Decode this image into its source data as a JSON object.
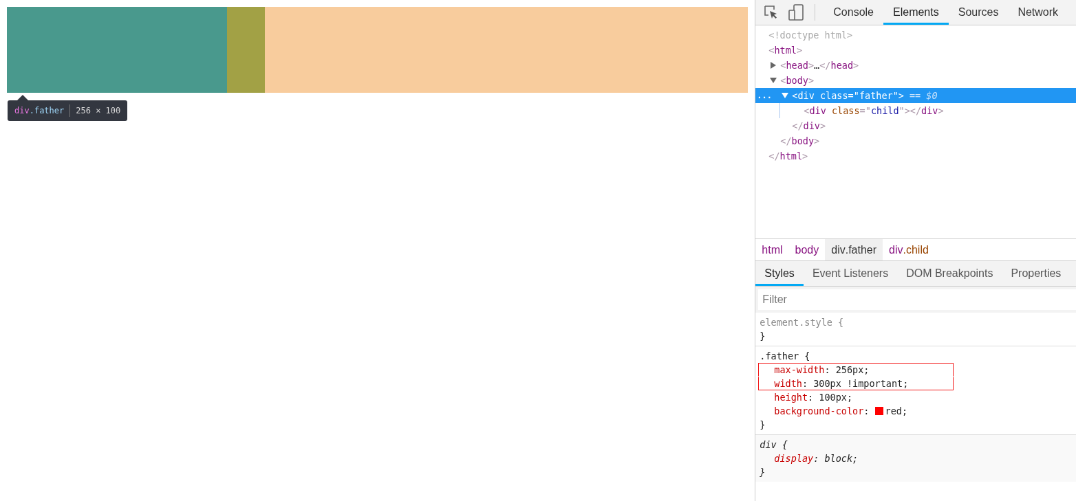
{
  "page": {
    "tooltip": {
      "selector_tag": "div",
      "selector_class": ".father",
      "size": "256 × 100"
    }
  },
  "devtools": {
    "tabs": [
      {
        "label": "Console",
        "selected": false
      },
      {
        "label": "Elements",
        "selected": true
      },
      {
        "label": "Sources",
        "selected": false
      },
      {
        "label": "Network",
        "selected": false
      }
    ],
    "dom_tree": [
      {
        "selected": false,
        "open": [
          {
            "c": "<!doctype html>"
          }
        ]
      },
      {
        "selected": false,
        "open": [
          {
            "p": "<"
          },
          {
            "t": "html"
          },
          {
            "p": ">"
          }
        ],
        "close": [
          {
            "p": "</"
          },
          {
            "t": "html"
          },
          {
            "p": ">"
          }
        ],
        "children": [
          {
            "selected": false,
            "expanded": false,
            "open": [
              {
                "p": "<"
              },
              {
                "t": "head"
              },
              {
                "p": ">"
              },
              {
                "x": "…"
              },
              {
                "p": "</"
              },
              {
                "t": "head"
              },
              {
                "p": ">"
              }
            ]
          },
          {
            "selected": false,
            "expanded": true,
            "open": [
              {
                "p": "<"
              },
              {
                "t": "body"
              },
              {
                "p": ">"
              }
            ],
            "close": [
              {
                "p": "</"
              },
              {
                "t": "body"
              },
              {
                "p": ">"
              }
            ],
            "children": [
              {
                "selected": true,
                "expanded": true,
                "marker": "...",
                "suffix": "== $0",
                "open": [
                  {
                    "p": "<"
                  },
                  {
                    "t": "div"
                  },
                  {
                    "a": " class"
                  },
                  {
                    "p": "=\""
                  },
                  {
                    "v": "father"
                  },
                  {
                    "p": "\">"
                  }
                ],
                "close": [
                  {
                    "p": "</"
                  },
                  {
                    "t": "div"
                  },
                  {
                    "p": ">"
                  }
                ],
                "children": [
                  {
                    "selected": false,
                    "open": [
                      {
                        "p": "<"
                      },
                      {
                        "t": "div"
                      },
                      {
                        "a": " class"
                      },
                      {
                        "p": "=\""
                      },
                      {
                        "v": "child"
                      },
                      {
                        "p": "\"></"
                      },
                      {
                        "t": "div"
                      },
                      {
                        "p": ">"
                      }
                    ]
                  }
                ]
              }
            ]
          }
        ]
      }
    ],
    "breadcrumbs": [
      {
        "tag": "html",
        "selected": false
      },
      {
        "tag": "body",
        "selected": false
      },
      {
        "tag": "div",
        "cls": ".father",
        "selected": true
      },
      {
        "tag": "div",
        "cls": ".child",
        "selected": false
      }
    ],
    "subtabs": [
      {
        "label": "Styles",
        "selected": true
      },
      {
        "label": "Event Listeners",
        "selected": false
      },
      {
        "label": "DOM Breakpoints",
        "selected": false
      },
      {
        "label": "Properties",
        "selected": false
      }
    ],
    "filter": {
      "placeholder": "Filter"
    },
    "rules": [
      {
        "kind": "inline",
        "selector": "element.style {",
        "end": "}"
      },
      {
        "kind": "author",
        "selector": ".father {",
        "end": "}",
        "declarations": [
          {
            "property": "max-width",
            "colon": ":",
            "value": "256px;",
            "boxed": true
          },
          {
            "property": "width",
            "colon": ":",
            "value": "300px !important;",
            "boxed": true
          },
          {
            "property": "height",
            "colon": ":",
            "value": "100px;",
            "boxed": false
          },
          {
            "property": "background-color",
            "colon": ":",
            "value": "red;",
            "color": "#ff0000",
            "boxed": false
          }
        ]
      },
      {
        "kind": "useragent",
        "selector": "div {",
        "end": "}",
        "declarations": [
          {
            "property": "display",
            "colon": ":",
            "value": "block;",
            "boxed": false
          }
        ]
      }
    ]
  }
}
